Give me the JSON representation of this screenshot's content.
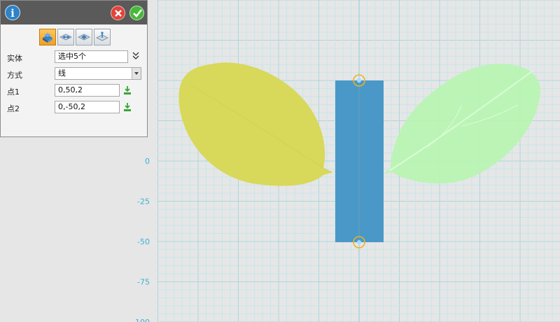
{
  "panel": {
    "info_icon": "info-icon",
    "close_icon": "close-icon",
    "confirm_icon": "checkmark-icon",
    "mode_buttons": [
      {
        "icon": "solid-split-icon",
        "active": true
      },
      {
        "icon": "plane-split-icon",
        "active": false
      },
      {
        "icon": "face-split-icon",
        "active": false
      },
      {
        "icon": "point-split-icon",
        "active": false
      }
    ],
    "entity_label": "实体",
    "entity_value": "选中5个",
    "method_label": "方式",
    "method_value": "线",
    "point1_label": "点1",
    "point1_value": "0,50,2",
    "point2_label": "点2",
    "point2_value": "0,-50,2",
    "pick_icon": "pick-point-icon",
    "expand_icon": "double-chevron-down-icon"
  },
  "viewport": {
    "axis_labels": [
      "0",
      "-25",
      "-50",
      "-75",
      "-100"
    ],
    "objects": [
      "yellow-leaf",
      "blue-rectangle",
      "green-leaf"
    ],
    "colors": {
      "background": "#e6e6e6",
      "grid_minor": "#c7e6ea",
      "grid_major": "#a9d8df",
      "axis_label": "#36b4d4",
      "yellow_leaf": "#d8d85a",
      "green_leaf": "#b7f5b0",
      "rectangle": "#4a98c8",
      "handle": "#f0b020"
    }
  }
}
